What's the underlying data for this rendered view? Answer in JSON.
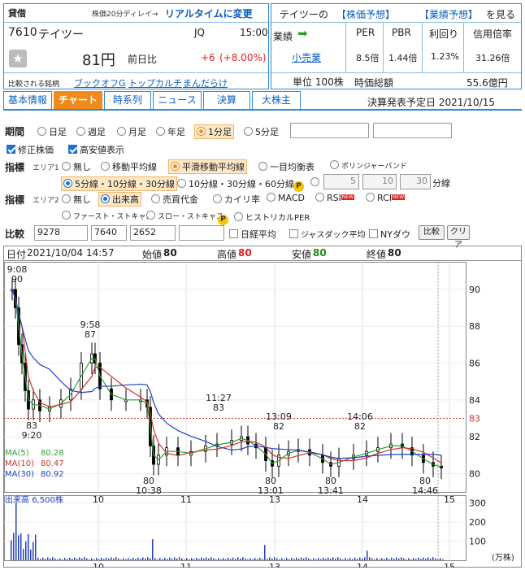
{
  "header": {
    "badge": "貸借",
    "delay_note": "株価20分ディレイ→",
    "realtime_link": "リアルタイムに変更",
    "code": "7610",
    "name": "テイツー",
    "market": "JQ",
    "time": "15:00",
    "price": "81円",
    "change_label": "前日比",
    "change": "+6",
    "change_pct": "(+8.00%)",
    "compare_label": "比較される銘柄",
    "compare_links": [
      "ブックオフG",
      "トップカルチ",
      "まんだらけ"
    ],
    "forecast_prefix": "テイツーの",
    "forecast_price": "【株価予想】",
    "forecast_perf": "【業績予想】",
    "forecast_suffix": "を見る",
    "industry_label": "業績",
    "industry": "小売業",
    "unit": "単位 100株",
    "per_label": "PER",
    "per": "8.5倍",
    "pbr_label": "PBR",
    "pbr": "1.44倍",
    "yield_label": "利回り",
    "yield": "1.23%",
    "credit_label": "信用倍率",
    "credit": "31.26倍",
    "mcap_label": "時価総額",
    "mcap": "55.6億円"
  },
  "tabs": [
    "基本情報",
    "チャート",
    "時系列",
    "ニュース",
    "決算",
    "大株主"
  ],
  "active_tab": 1,
  "earnings_date": "決算発表予定日 2021/10/15",
  "form": {
    "period_label": "期間",
    "periods": [
      "日足",
      "週足",
      "月足",
      "年足",
      "1分足",
      "5分足"
    ],
    "adjusted": "修正株価",
    "high_low": "高安値表示",
    "indicator_label": "指標",
    "area1": "エリア1",
    "area1_opts": [
      "無し",
      "移動平均線",
      "平滑移動平均線",
      "一目均衡表",
      "ボリンジャーバンド"
    ],
    "ma_opt1": "5分線・10分線・30分線",
    "ma_opt2": "10分線・30分線・60分線",
    "ma_inputs": [
      "5",
      "10",
      "30"
    ],
    "ma_unit": "分線",
    "area2": "エリア2",
    "area2_opts": [
      "無し",
      "出来高",
      "売買代金",
      "カイリ率",
      "MACD",
      "RSI",
      "RCI"
    ],
    "area2_row2": [
      "ファースト・ストキャス",
      "スロー・ストキャス",
      "ヒストリカルPER"
    ],
    "new_badge": "NEW",
    "p_badge": "P",
    "compare_label": "比較",
    "compare_inputs": [
      "9278",
      "7640",
      "2652",
      ""
    ],
    "compare_opts": [
      "日経平均",
      "ジャスダック平均",
      "NYダウ"
    ],
    "compare_btn": "比較",
    "clear_btn": "クリア"
  },
  "chart_header": {
    "date_label": "日付",
    "date": "2021/10/04 14:57",
    "open_label": "始値",
    "open": "80",
    "high_label": "高値",
    "high": "80",
    "low_label": "安値",
    "low": "80",
    "close_label": "終値",
    "close": "80"
  },
  "ma_legend": [
    {
      "label": "MA(5)",
      "value": "80.28",
      "color": "#2e9e2e"
    },
    {
      "label": "MA(10)",
      "value": "80.47",
      "color": "#d03030"
    },
    {
      "label": "MA(30)",
      "value": "80.92",
      "color": "#2040c0"
    }
  ],
  "volume_label": "出来高",
  "volume_value": "6,500株",
  "volume_unit": "(万株)",
  "chart_data": [
    {
      "type": "candlestick",
      "title": "",
      "x_ticks": [
        "10",
        "11",
        "13",
        "14",
        "15"
      ],
      "y_ticks": [
        80,
        82,
        84,
        86,
        88,
        90
      ],
      "ylim": [
        79,
        91.5
      ],
      "reference_line": 83,
      "annotations": [
        {
          "time": "9:08",
          "value": 90
        },
        {
          "time": "9:20",
          "value": 83
        },
        {
          "time": "9:58",
          "value": 87
        },
        {
          "time": "10:38",
          "value": 80
        },
        {
          "time": "11:27",
          "value": 83
        },
        {
          "time": "13:01",
          "value": 80
        },
        {
          "time": "13:09",
          "value": 82
        },
        {
          "time": "13:41",
          "value": 80
        },
        {
          "time": "14:06",
          "value": 82
        },
        {
          "time": "14:46",
          "value": 80
        }
      ],
      "series": [
        {
          "name": "MA(5)",
          "last": 80.28
        },
        {
          "name": "MA(10)",
          "last": 80.47
        },
        {
          "name": "MA(30)",
          "last": 80.92
        }
      ]
    },
    {
      "type": "bar",
      "title": "",
      "x_ticks": [
        "10",
        "11",
        "13",
        "14",
        "15"
      ],
      "y_ticks": [
        100,
        200,
        300
      ],
      "ylim": [
        0,
        340
      ]
    }
  ]
}
